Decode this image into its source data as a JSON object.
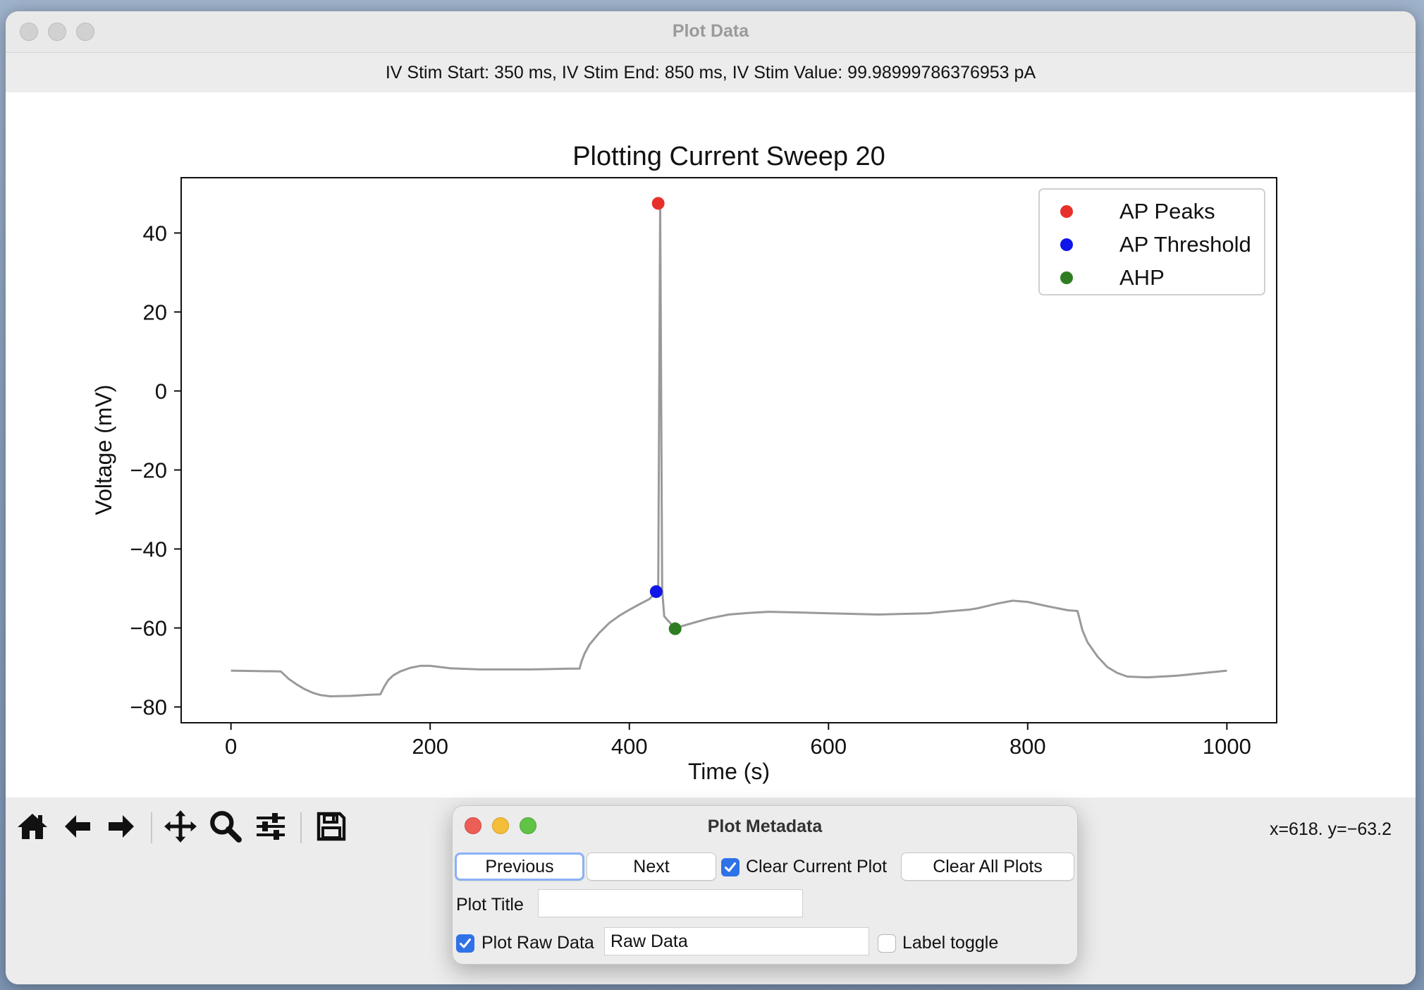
{
  "window": {
    "title": "Plot Data"
  },
  "info_bar": {
    "text": "IV Stim Start: 350 ms, IV Stim End: 850 ms, IV Stim Value: 99.98999786376953 pA"
  },
  "toolbar": {
    "icons": [
      "home-icon",
      "back-arrow-icon",
      "forward-arrow-icon",
      "pan-icon",
      "zoom-icon",
      "configure-subplots-icon",
      "save-icon"
    ],
    "coords": "x=618. y=−63.2"
  },
  "chart_data": {
    "type": "line",
    "title": "Plotting Current Sweep 20",
    "xlabel": "Time (s)",
    "ylabel": "Voltage (mV)",
    "xlim": [
      -50,
      1050
    ],
    "ylim": [
      -84,
      54
    ],
    "xticks": [
      0,
      200,
      400,
      600,
      800,
      1000
    ],
    "xtick_labels": [
      "0",
      "200",
      "400",
      "600",
      "800",
      "1000"
    ],
    "yticks": [
      40,
      20,
      0,
      -20,
      -40,
      -60,
      -80
    ],
    "ytick_labels": [
      "40",
      "20",
      "0",
      "−20",
      "−40",
      "−60",
      "−80"
    ],
    "grid": false,
    "legend_position": "top-right",
    "trace_color": "#9a9a9a",
    "trace": {
      "x": [
        0,
        50,
        58,
        66,
        74,
        82,
        90,
        100,
        120,
        140,
        150,
        154,
        158,
        163,
        170,
        180,
        190,
        200,
        220,
        250,
        300,
        340,
        350,
        352,
        355,
        360,
        370,
        380,
        390,
        400,
        410,
        420,
        425,
        427,
        429,
        431,
        433,
        435,
        438,
        442,
        446,
        452,
        460,
        470,
        480,
        500,
        520,
        540,
        560,
        600,
        650,
        700,
        720,
        740,
        750,
        770,
        785,
        800,
        820,
        840,
        850,
        855,
        860,
        870,
        880,
        890,
        900,
        920,
        950,
        1000
      ],
      "y": [
        -70.8,
        -71,
        -72.9,
        -74.3,
        -75.5,
        -76.4,
        -77,
        -77.3,
        -77.2,
        -76.9,
        -76.8,
        -74.8,
        -73.2,
        -72,
        -71,
        -70.1,
        -69.6,
        -69.6,
        -70.2,
        -70.5,
        -70.5,
        -70.3,
        -70.3,
        -68.5,
        -66.5,
        -64.2,
        -61.2,
        -58.7,
        -56.9,
        -55.4,
        -54,
        -52.7,
        -51.5,
        -51,
        -50.8,
        47.5,
        -50.3,
        -57,
        -57.9,
        -59,
        -60.2,
        -59.6,
        -59,
        -58.3,
        -57.6,
        -56.6,
        -56.2,
        -55.9,
        -56,
        -56.3,
        -56.6,
        -56.3,
        -55.8,
        -55.4,
        -55,
        -53.8,
        -53.1,
        -53.4,
        -54.5,
        -55.5,
        -55.7,
        -60.6,
        -63.6,
        -67.2,
        -69.9,
        -71.4,
        -72.3,
        -72.5,
        -72.1,
        -70.8
      ]
    },
    "series": [
      {
        "name": "AP Peaks",
        "color": "#e8302a",
        "x": [
          429
        ],
        "y": [
          47.5
        ]
      },
      {
        "name": "AP Threshold",
        "color": "#1016e8",
        "x": [
          427
        ],
        "y": [
          -50.8
        ]
      },
      {
        "name": "AHP",
        "color": "#2f7d23",
        "x": [
          446
        ],
        "y": [
          -60.2
        ]
      }
    ]
  },
  "metadata_window": {
    "title": "Plot Metadata",
    "previous_label": "Previous",
    "next_label": "Next",
    "clear_current_label": "Clear Current Plot",
    "clear_current_checked": true,
    "clear_all_label": "Clear All Plots",
    "plot_title_label": "Plot Title",
    "plot_title_value": "",
    "plot_raw_label": "Plot Raw Data",
    "plot_raw_checked": true,
    "raw_data_value": "Raw Data",
    "label_toggle_label": "Label toggle",
    "label_toggle_checked": false
  }
}
